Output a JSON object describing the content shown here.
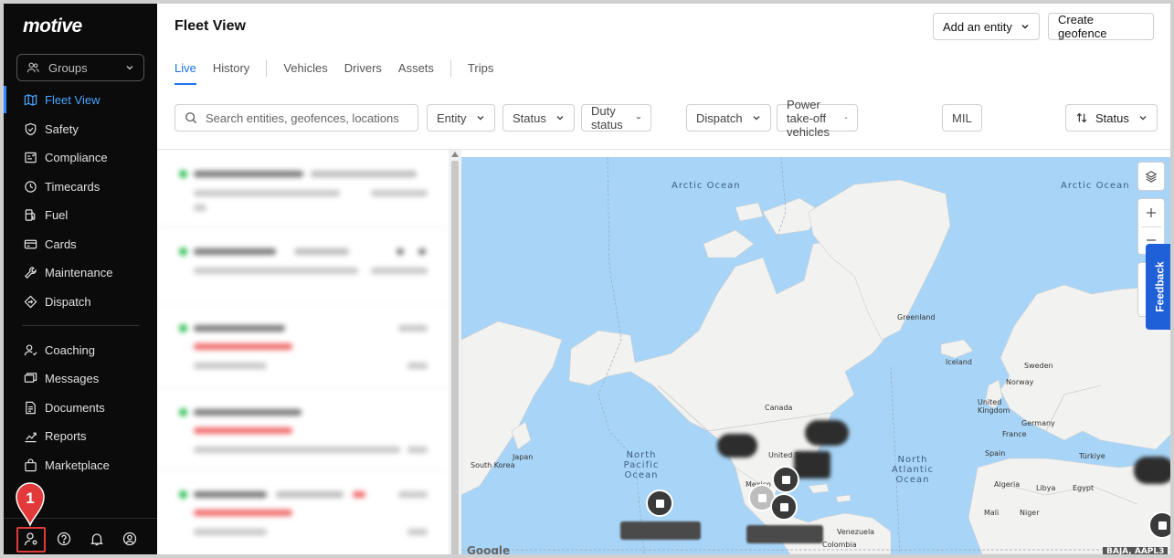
{
  "app": {
    "logo": "motive"
  },
  "sidebar": {
    "groups_label": "Groups",
    "items": [
      {
        "label": "Fleet View",
        "icon": "map-icon",
        "active": true
      },
      {
        "label": "Safety",
        "icon": "shield-icon"
      },
      {
        "label": "Compliance",
        "icon": "compliance-icon"
      },
      {
        "label": "Timecards",
        "icon": "clock-icon"
      },
      {
        "label": "Fuel",
        "icon": "fuel-icon"
      },
      {
        "label": "Cards",
        "icon": "card-icon"
      },
      {
        "label": "Maintenance",
        "icon": "wrench-icon"
      },
      {
        "label": "Dispatch",
        "icon": "dispatch-icon"
      },
      {
        "label": "Coaching",
        "icon": "coaching-icon"
      },
      {
        "label": "Messages",
        "icon": "messages-icon"
      },
      {
        "label": "Documents",
        "icon": "document-icon"
      },
      {
        "label": "Reports",
        "icon": "reports-icon"
      },
      {
        "label": "Marketplace",
        "icon": "bag-icon"
      }
    ],
    "bottom_icons": [
      "user-settings-icon",
      "help-icon",
      "bell-icon",
      "profile-icon"
    ],
    "callout_number": "1",
    "callout_color": "#e23a3a"
  },
  "header": {
    "title": "Fleet View",
    "add_entity_label": "Add an entity",
    "create_geofence_label": "Create geofence",
    "tabs": [
      "Live",
      "History",
      "Vehicles",
      "Drivers",
      "Assets",
      "Trips"
    ],
    "active_tab": "Live"
  },
  "filters": {
    "search_placeholder": "Search entities, geofences, locations",
    "entity": "Entity",
    "status": "Status",
    "duty_status": "Duty status",
    "dispatch": "Dispatch",
    "pto": "Power take-off vehicles",
    "mil": "MIL",
    "sort": "Status"
  },
  "map": {
    "labels": {
      "arctic_ocean_1": "Arctic Ocean",
      "arctic_ocean_2": "Arctic Ocean",
      "north_pacific": "North Pacific Ocean",
      "north_atlantic": "North Atlantic Ocean",
      "greenland": "Greenland",
      "iceland": "Iceland",
      "norway": "Norway",
      "sweden": "Sweden",
      "uk": "United Kingdom",
      "germany": "Germany",
      "france": "France",
      "spain": "Spain",
      "turkiye": "Türkiye",
      "algeria": "Algeria",
      "libya": "Libya",
      "egypt": "Egypt",
      "mali": "Mali",
      "niger": "Niger",
      "canada": "Canada",
      "united_states": "United States",
      "mexico": "Mexico",
      "venezuela": "Venezuela",
      "colombia": "Colombia",
      "japan": "Japan",
      "south_korea": "South Korea",
      "google": "Google",
      "corner_label": "BAJA, AAPL3"
    },
    "ocean_color": "#a8d5f7",
    "land_color": "#f2f2f0"
  },
  "feedback_label": "Feedback"
}
